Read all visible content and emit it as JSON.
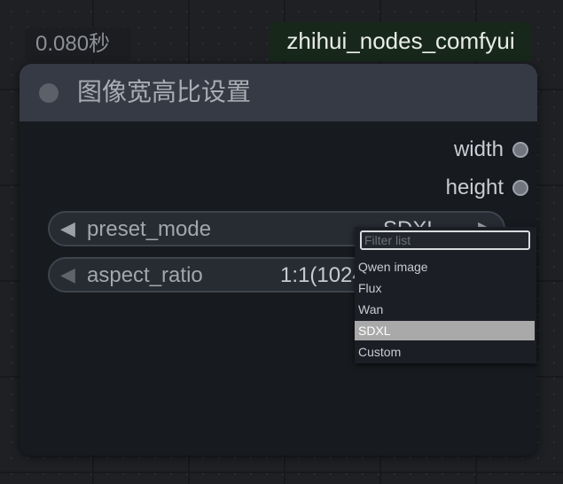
{
  "timer": "0.080秒",
  "node_tag": "zhihui_nodes_comfyui",
  "node": {
    "title": "图像宽高比设置",
    "outputs": [
      {
        "label": "width"
      },
      {
        "label": "height"
      }
    ],
    "widgets": {
      "preset_mode": {
        "label": "preset_mode",
        "value": "SDXL"
      },
      "aspect_ratio": {
        "label": "aspect_ratio",
        "value": "1:1(1024"
      }
    }
  },
  "dropdown": {
    "placeholder": "Filter list",
    "items": [
      "Qwen image",
      "Flux",
      "Wan",
      "SDXL",
      "Custom"
    ],
    "selected": "SDXL"
  },
  "colors": {
    "canvas": "#1e2024",
    "node_body": "#171a1f",
    "node_header": "#353a44",
    "tag_bg": "#17281a",
    "selected_item": "#a9a9a9"
  }
}
